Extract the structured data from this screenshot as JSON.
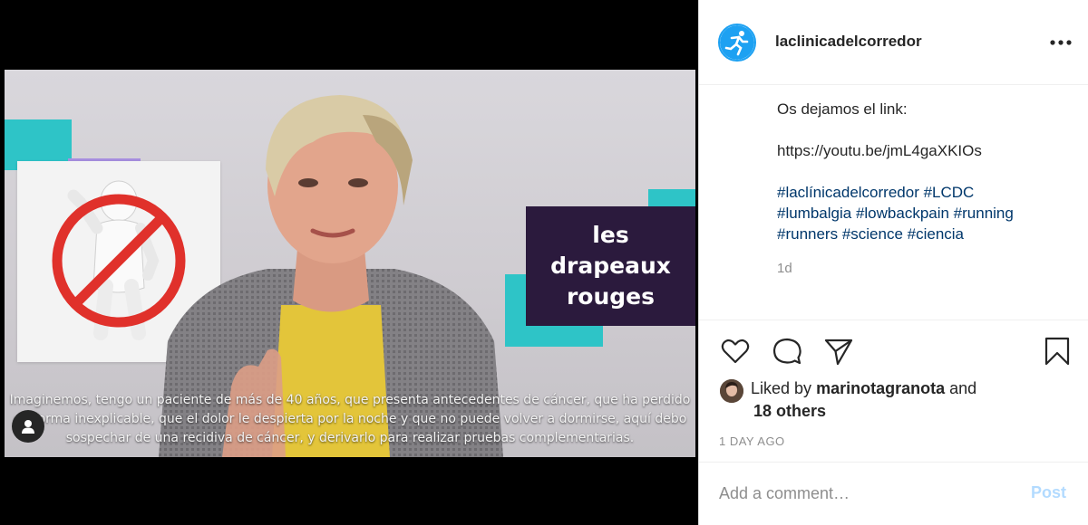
{
  "video": {
    "overlay_lines": [
      "les",
      "drapeaux",
      "rouges"
    ],
    "subtitle": "Imaginemos, tengo un paciente de más de 40 años, que presenta antecedentes de cáncer, que ha perdido de forma inexplicable, que el dolor le despierta por la noche y que no puede volver a dormirse, aquí debo sospechar de una recidiva de cáncer, y derivarlo para realizar pruebas complementarias.",
    "accent_color": "#2ec4c7",
    "overlay_color": "#2b1a3d"
  },
  "post": {
    "username": "laclinicadelcorredor",
    "more_icon": "more-horizontal-icon",
    "caption_line1": "Os dejamos el link:",
    "caption_link": "https://youtu.be/jmL4gaXKIOs",
    "hashtags_line1": "#laclínicadelcorredor #LCDC",
    "hashtags_line2": "#lumbalgia #lowbackpain #running",
    "hashtags_line3": "#runners #science #ciencia",
    "caption_time": "1d",
    "liked_prefix": "Liked by",
    "liked_user": "marinotagranota",
    "liked_and": "and",
    "liked_others": "18 others",
    "date": "1 DAY AGO",
    "comment_placeholder": "Add a comment…",
    "post_label": "Post",
    "icons": [
      "heart-icon",
      "comment-icon",
      "share-icon",
      "bookmark-icon"
    ]
  }
}
